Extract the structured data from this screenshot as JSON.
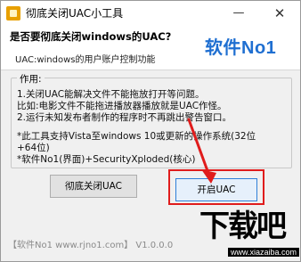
{
  "window": {
    "title": "彻底关闭UAC小工具",
    "minimize_glyph": "—",
    "close_glyph": "✕"
  },
  "header": {
    "title": "是否要彻底关闭windows的UAC?",
    "subtitle": "UAC:windows的用户账户控制功能",
    "brand": "软件No1"
  },
  "group": {
    "legend": "作用:",
    "lines": [
      "1.关闭UAC能解决文件不能拖放打开等问题。",
      "  比如:电影文件不能拖进播放器播放就是UAC作怪。",
      "2.运行未知发布者制作的程序时不再跳出警告窗口。",
      "*此工具支持Vista至windows 10或更新的操作系统(32位",
      "+64位)",
      "*软件No1(界面)+SecurityXploded(核心)"
    ]
  },
  "buttons": {
    "close_uac": "彻底关闭UAC",
    "open_uac": "开启UAC"
  },
  "footer": {
    "text": "【软件No1 www.rjno1.com】 V1.0.0.0"
  },
  "watermark": {
    "big_text": "下载吧",
    "url": "www.xiazaiba.com"
  },
  "colors": {
    "brand_blue": "#1f6fd1",
    "highlight_red": "#e01c1c"
  }
}
